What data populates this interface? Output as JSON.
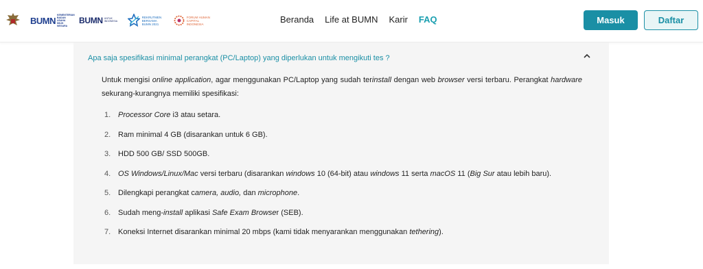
{
  "header": {
    "logos": {
      "bumn_mark": "BUMN",
      "bumn_mark_sub": "KEMENTERIAN BADAN USAHA MILIK NEGARA",
      "bumn_word": "BUMN",
      "bumn_word_sub": "UNTUK INDONESIA",
      "rekrutmen": "REKRUTMEN BERSAMA BUMN 2021",
      "fhc": "FORUM HUMAN CAPITAL INDONESIA"
    },
    "nav": {
      "beranda": "Beranda",
      "life": "Life at BUMN",
      "karir": "Karir",
      "faq": "FAQ"
    },
    "masuk": "Masuk",
    "daftar": "Daftar",
    "colors": {
      "accent": "#1a8fa5",
      "nav_active": "#1a9fb0"
    }
  },
  "faq": {
    "question": "Apa saja spesifikasi minimal perangkat (PC/Laptop) yang diperlukan untuk mengikuti tes ?",
    "intro": {
      "p1": "Untuk mengisi ",
      "p2": "online application",
      "p3": ", agar menggunakan PC/Laptop yang sudah ter",
      "p4": "install",
      "p5": " dengan web ",
      "p6": "browser",
      "p7": " versi terbaru. Perangkat ",
      "p8": "hardware",
      "p9": " sekurang-kurangnya memiliki spesifikasi:"
    },
    "items": [
      {
        "num": "1.",
        "a": "Processor Core",
        "b": " i3 atau setara."
      },
      {
        "num": "2.",
        "a": "Ram minimal 4 GB (disarankan untuk 6 GB)."
      },
      {
        "num": "3.",
        "a": "HDD 500 GB/ SSD 500GB."
      },
      {
        "num": "4.",
        "a": "OS Windows/Linux/Mac",
        "b": " versi terbaru (disarankan ",
        "c": "windows",
        "d": " 10 (64-bit) atau ",
        "e": "windows",
        "f": " 11 serta ",
        "g": "macOS",
        "h": " 11 (",
        "i": "Big Sur",
        "j": " atau lebih baru)."
      },
      {
        "num": "5.",
        "a": "Dilengkapi perangkat c",
        "b": "amera, audio,",
        "c": " dan ",
        "d": "microphone",
        "e": "."
      },
      {
        "num": "6.",
        "a": "Sudah meng-",
        "b": "install",
        "c": " aplikasi ",
        "d": "Safe Exam Browse",
        "e": "r (SEB)."
      },
      {
        "num": "7.",
        "a": "Koneksi Internet disarankan minimal 20 mbps (kami tidak menyarankan menggunakan ",
        "b": "tethering",
        "c": ")."
      }
    ]
  }
}
